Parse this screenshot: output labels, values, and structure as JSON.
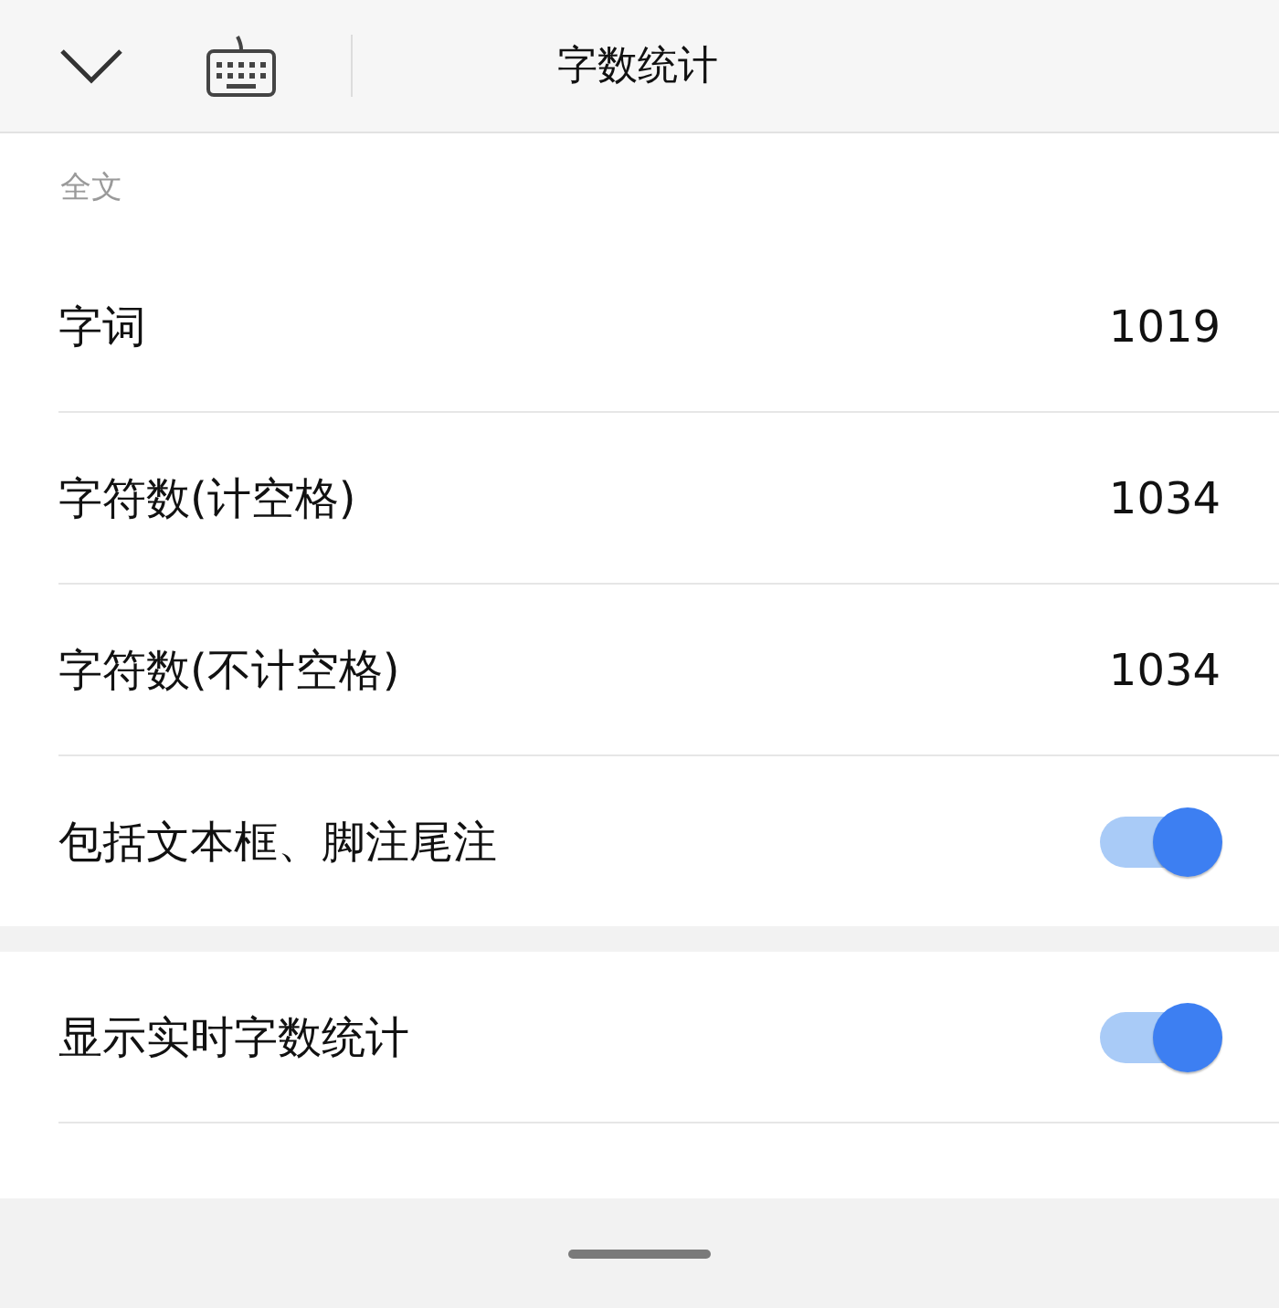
{
  "header": {
    "title": "字数统计"
  },
  "sections": [
    {
      "label": "全文",
      "rows": [
        {
          "kind": "value",
          "label": "字词",
          "value": "1019"
        },
        {
          "kind": "value",
          "label": "字符数(计空格)",
          "value": "1034"
        },
        {
          "kind": "value",
          "label": "字符数(不计空格)",
          "value": "1034"
        },
        {
          "kind": "toggle",
          "label": "包括文本框、脚注尾注",
          "on": true
        }
      ]
    },
    {
      "rows": [
        {
          "kind": "toggle",
          "label": "显示实时字数统计",
          "on": true
        }
      ]
    }
  ]
}
